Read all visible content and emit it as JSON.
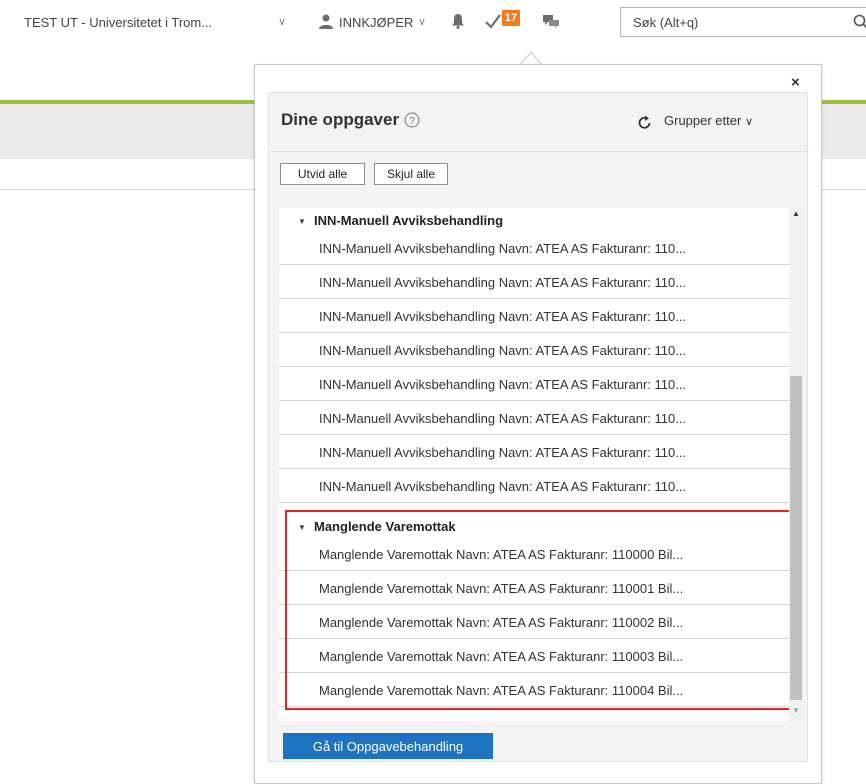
{
  "header": {
    "org_name": "TEST UT - Universitetet i Trom...",
    "role_label": "INNKJØPER",
    "tasks_badge": "17",
    "search": {
      "placeholder": "Søk (Alt+q)",
      "value": ""
    }
  },
  "tasks_panel": {
    "title": "Dine oppgaver",
    "group_by_label": "Grupper etter",
    "expand_all_label": "Utvid alle",
    "collapse_all_label": "Skjul alle",
    "close_symbol": "×",
    "groups": [
      {
        "name": "INN-Manuell Avviksbehandling",
        "items": [
          "INN-Manuell Avviksbehandling Navn: ATEA AS Fakturanr: 110...",
          "INN-Manuell Avviksbehandling Navn: ATEA AS Fakturanr: 110...",
          "INN-Manuell Avviksbehandling Navn: ATEA AS Fakturanr: 110...",
          "INN-Manuell Avviksbehandling Navn: ATEA AS Fakturanr: 110...",
          "INN-Manuell Avviksbehandling Navn: ATEA AS Fakturanr: 110...",
          "INN-Manuell Avviksbehandling Navn: ATEA AS Fakturanr: 110...",
          "INN-Manuell Avviksbehandling Navn: ATEA AS Fakturanr: 110...",
          "INN-Manuell Avviksbehandling Navn: ATEA AS Fakturanr: 110..."
        ]
      },
      {
        "name": "Manglende Varemottak",
        "items": [
          "Manglende Varemottak Navn: ATEA AS Fakturanr: 110000 Bil...",
          "Manglende Varemottak Navn: ATEA AS Fakturanr: 110001 Bil...",
          "Manglende Varemottak Navn: ATEA AS Fakturanr: 110002 Bil...",
          "Manglende Varemottak Navn: ATEA AS Fakturanr: 110003 Bil...",
          "Manglende Varemottak Navn: ATEA AS Fakturanr: 110004 Bil..."
        ]
      }
    ],
    "goto_button_label": "Gå til Oppgavebehandling"
  },
  "colors": {
    "accent_green": "#9bc23c",
    "badge_orange": "#f07c1c",
    "primary_blue": "#1d73bf",
    "highlight_red": "#e8202a"
  }
}
